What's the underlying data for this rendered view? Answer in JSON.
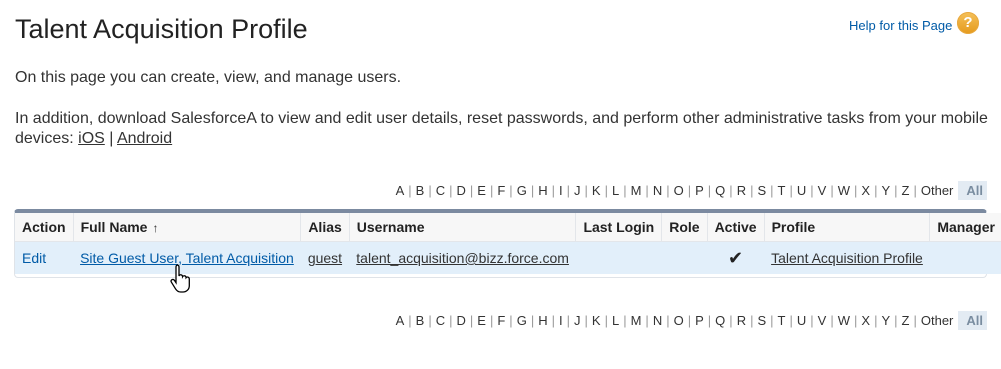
{
  "page": {
    "title": "Talent Acquisition Profile",
    "help_link": "Help for this Page",
    "help_icon": "?",
    "intro": "On this page you can create, view, and manage users.",
    "info_text": "In addition, download SalesforceA to view and edit user details, reset passwords, and perform other administrative tasks from your mobile devices: ",
    "ios_link": "iOS",
    "separator": "|",
    "android_link": "Android"
  },
  "alpha_filter": {
    "letters": [
      "A",
      "B",
      "C",
      "D",
      "E",
      "F",
      "G",
      "H",
      "I",
      "J",
      "K",
      "L",
      "M",
      "N",
      "O",
      "P",
      "Q",
      "R",
      "S",
      "T",
      "U",
      "V",
      "W",
      "X",
      "Y",
      "Z"
    ],
    "other": "Other",
    "all": "All"
  },
  "table": {
    "headers": [
      "Action",
      "Full Name",
      "Alias",
      "Username",
      "Last Login",
      "Role",
      "Active",
      "Profile",
      "Manager"
    ],
    "sort_indicator": "↑",
    "rows": [
      {
        "action": "Edit",
        "full_name": "Site Guest User, Talent Acquisition",
        "alias": "guest",
        "username": "talent_acquisition@bizz.force.com",
        "last_login": "",
        "role": "",
        "active": "✔",
        "profile": "Talent Acquisition Profile",
        "manager": ""
      }
    ]
  },
  "colors": {
    "link_blue": "#015ba7",
    "row_highlight": "#e2effa",
    "table_top_border": "#7b8aa0",
    "help_icon": "#e59a1c"
  }
}
